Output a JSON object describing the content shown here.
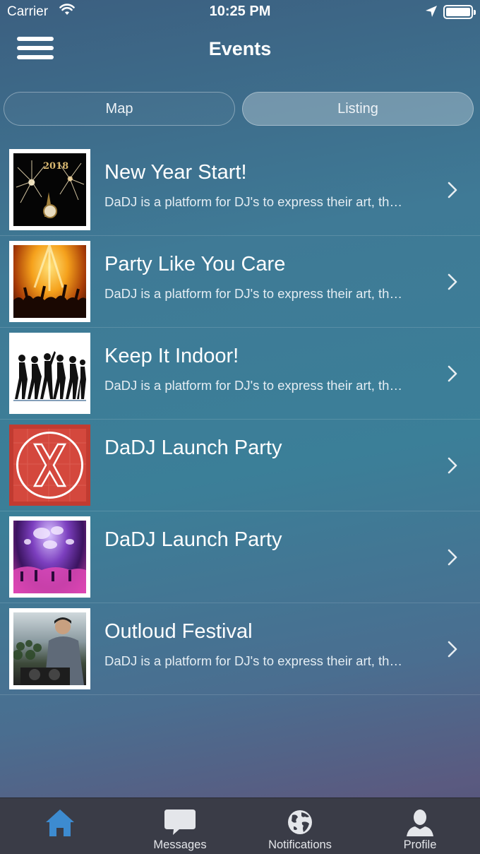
{
  "status_bar": {
    "carrier": "Carrier",
    "time": "10:25 PM"
  },
  "nav": {
    "title": "Events"
  },
  "segments": {
    "map_label": "Map",
    "listing_label": "Listing",
    "selected": "Listing"
  },
  "events": [
    {
      "title": "New Year Start!",
      "description": "DaDJ is a platform for DJ's to express their art, th…",
      "image": "fireworks-2018"
    },
    {
      "title": "Party Like You Care",
      "description": "DaDJ is a platform for DJ's to express their art, th…",
      "image": "concert-crowd"
    },
    {
      "title": "Keep It Indoor!",
      "description": "DaDJ is a platform for DJ's to express their art, th…",
      "image": "dancer-silhouettes"
    },
    {
      "title": "DaDJ Launch Party",
      "description": "",
      "image": "dadj-logo"
    },
    {
      "title": "DaDJ Launch Party",
      "description": "",
      "image": "nightclub"
    },
    {
      "title": "Outloud Festival",
      "description": "DaDJ is a platform for DJ's to express their art, th…",
      "image": "dj-at-decks"
    }
  ],
  "tab_bar": {
    "selected": "home",
    "tabs": [
      {
        "id": "home",
        "label": "",
        "icon": "home-icon"
      },
      {
        "id": "messages",
        "label": "Messages",
        "icon": "chat-bubble-icon"
      },
      {
        "id": "notifications",
        "label": "Notifications",
        "icon": "globe-icon"
      },
      {
        "id": "profile",
        "label": "Profile",
        "icon": "person-icon"
      }
    ]
  },
  "colors": {
    "tab_active": "#3d8bd0",
    "tab_inactive": "#e4e6ea",
    "tab_bar_bg": "#3a3c47"
  }
}
